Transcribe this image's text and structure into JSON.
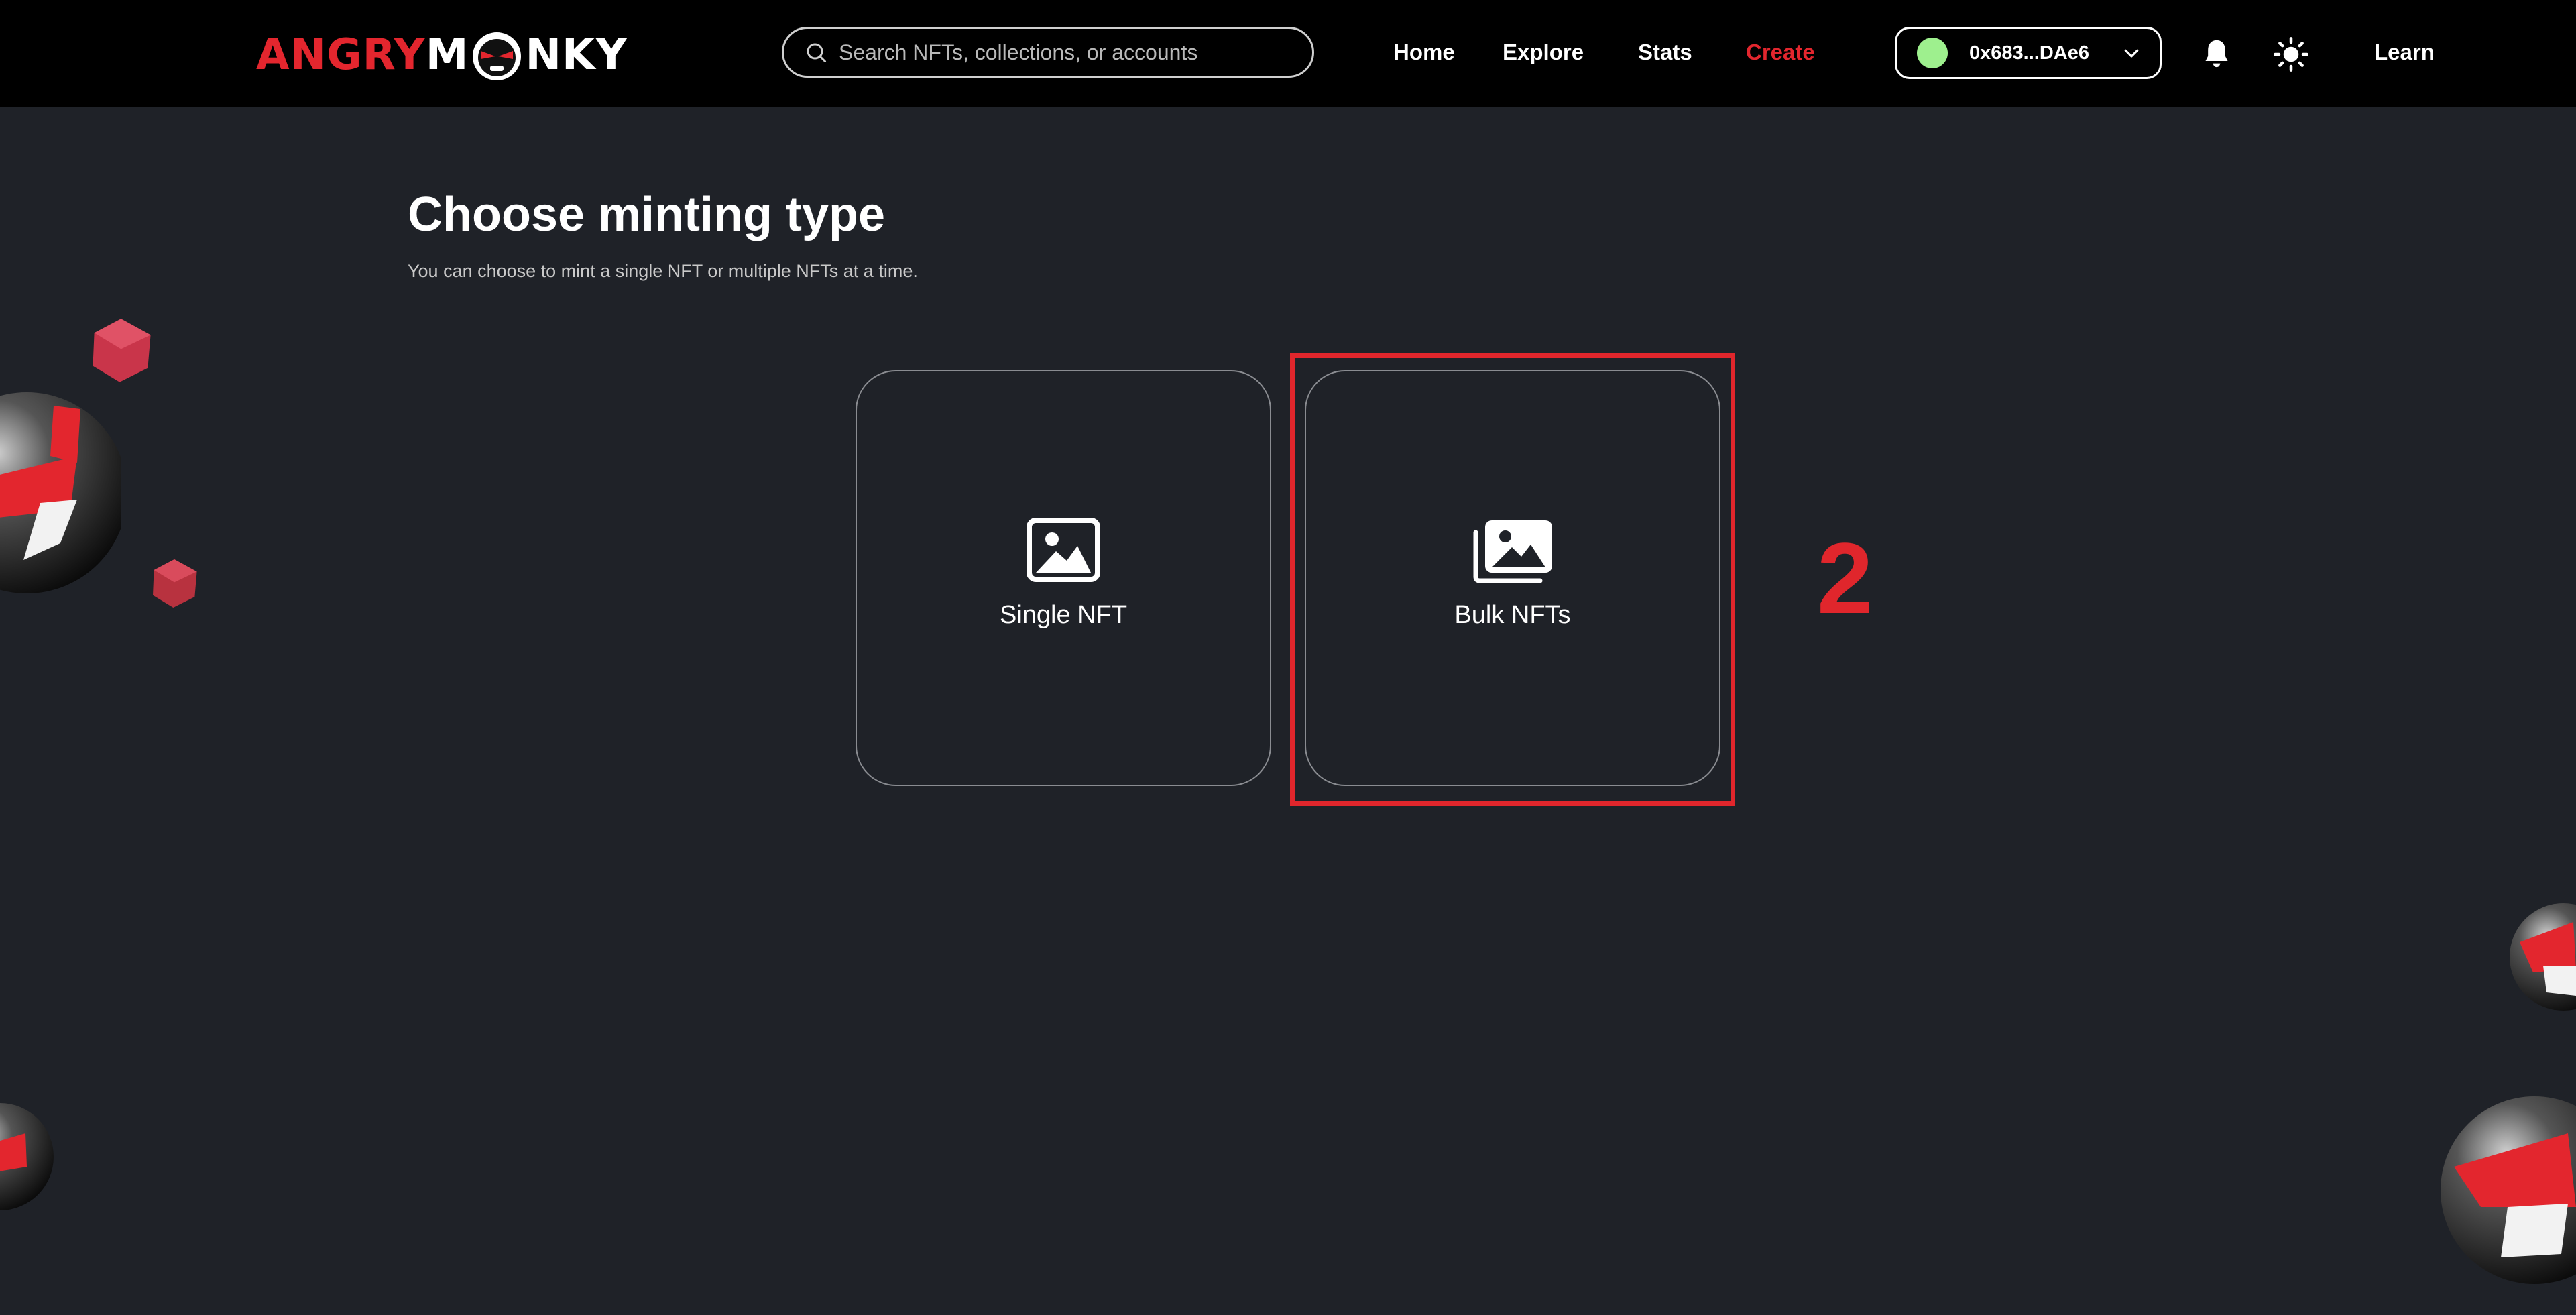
{
  "navbar": {
    "logo": {
      "part1": "ANGRY",
      "part2": "M",
      "part3": "NKY"
    },
    "search": {
      "placeholder": "Search NFTs, collections, or accounts"
    },
    "links": {
      "home": "Home",
      "explore": "Explore",
      "stats": "Stats",
      "create": "Create",
      "learn": "Learn"
    },
    "wallet": {
      "address": "0x683...DAe6"
    },
    "colors": {
      "create_active": "#e3262e",
      "wallet_dot": "#9ef08e"
    }
  },
  "page": {
    "title": "Choose minting type",
    "subtitle": "You can choose to mint a single NFT or multiple NFTs at a time."
  },
  "options": [
    {
      "label": "Single NFT",
      "icon": "image-icon"
    },
    {
      "label": "Bulk NFTs",
      "icon": "images-stack-icon"
    }
  ],
  "annotation": {
    "step": "2",
    "color": "#e0262c"
  }
}
